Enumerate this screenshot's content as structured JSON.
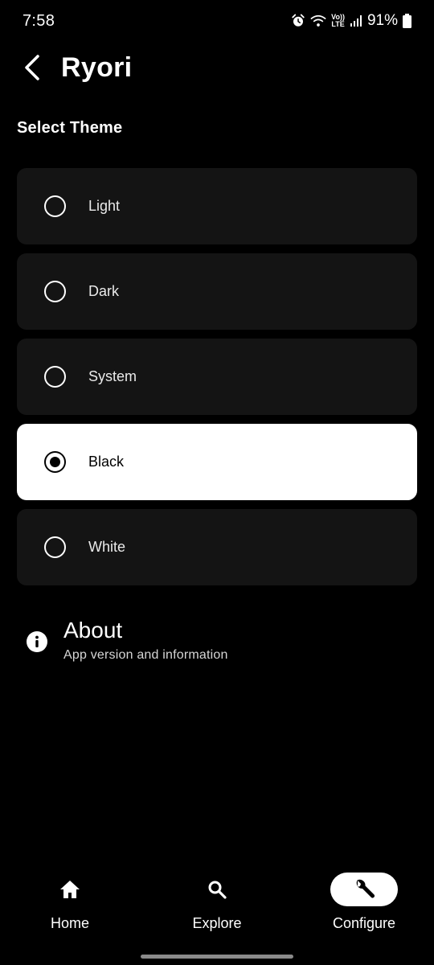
{
  "status_bar": {
    "time": "7:58",
    "lte_top": "Vo))",
    "lte_bottom": "LTE",
    "battery": "91%"
  },
  "header": {
    "title": "Ryori"
  },
  "section": {
    "title": "Select Theme"
  },
  "themes": [
    {
      "label": "Light",
      "selected": false
    },
    {
      "label": "Dark",
      "selected": false
    },
    {
      "label": "System",
      "selected": false
    },
    {
      "label": "Black",
      "selected": true
    },
    {
      "label": "White",
      "selected": false
    }
  ],
  "about": {
    "title": "About",
    "subtitle": "App version and information",
    "icon": "info-icon"
  },
  "bottom_nav": {
    "items": [
      {
        "label": "Home",
        "icon": "home-icon",
        "active": false
      },
      {
        "label": "Explore",
        "icon": "search-icon",
        "active": false
      },
      {
        "label": "Configure",
        "icon": "wrench-icon",
        "active": true
      }
    ]
  },
  "colors": {
    "background": "#000000",
    "card": "#141414",
    "selected_card": "#ffffff",
    "text": "#ffffff"
  }
}
